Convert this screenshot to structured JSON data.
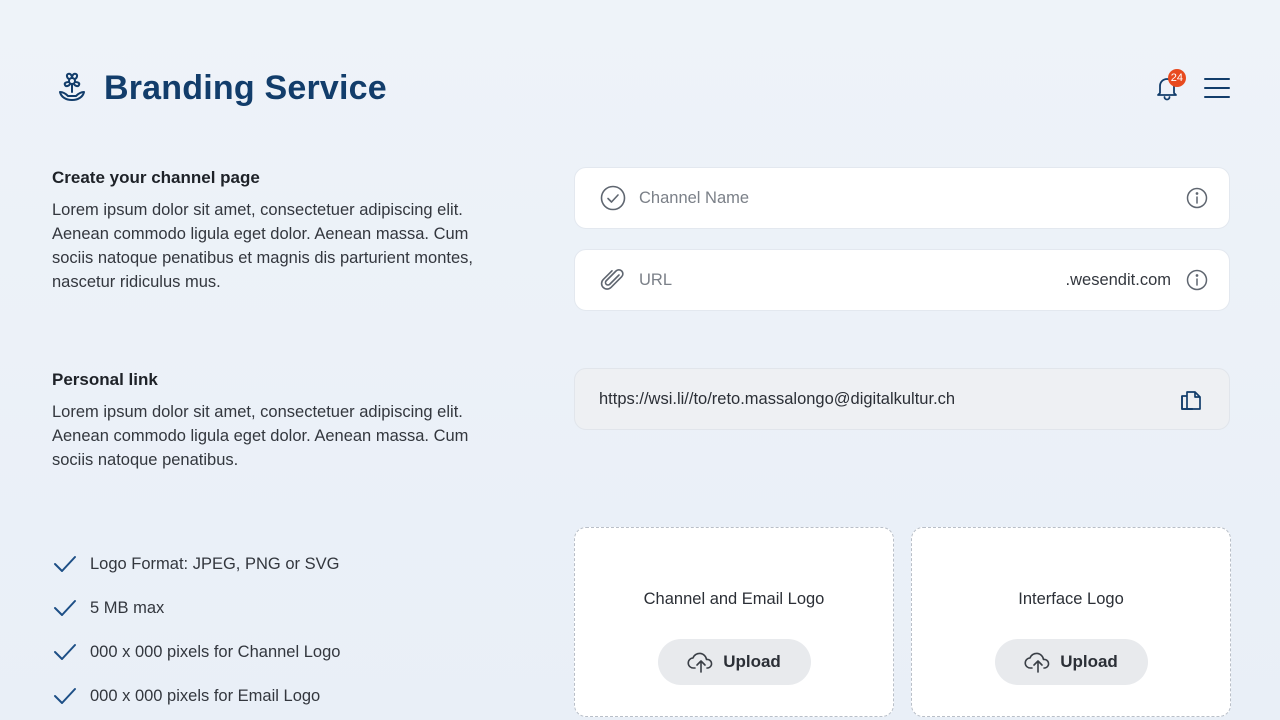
{
  "header": {
    "title": "Branding Service",
    "logo_icon": "flower-hand-icon",
    "notifications_count": "24"
  },
  "channel_section": {
    "title": "Create your channel page",
    "text": "Lorem ipsum dolor sit amet, consectetuer adipiscing elit. Aenean commodo ligula eget dolor. Aenean massa. Cum sociis natoque penatibus et magnis dis parturient montes, nascetur ridiculus mus."
  },
  "fields": {
    "channel_name": {
      "placeholder": "Channel Name",
      "value": ""
    },
    "url": {
      "placeholder": "URL",
      "value": "",
      "suffix": ".wesendit.com"
    }
  },
  "personal_section": {
    "title": "Personal link",
    "text": "Lorem ipsum dolor sit amet, consectetuer adipiscing elit. Aenean commodo ligula eget dolor. Aenean massa. Cum sociis natoque penatibus.",
    "link": "https://wsi.li//to/reto.massalongo@digitalkultur.ch"
  },
  "requirements": [
    "Logo Format: JPEG, PNG or SVG",
    "5 MB max",
    "000 x 000 pixels for Channel Logo",
    "000 x 000 pixels for Email Logo"
  ],
  "uploads": [
    {
      "label": "Channel and Email Logo",
      "button": "Upload"
    },
    {
      "label": "Interface Logo",
      "button": "Upload"
    }
  ],
  "colors": {
    "brand": "#123d6b",
    "badge": "#e84a1f",
    "check": "#1d4f86"
  }
}
